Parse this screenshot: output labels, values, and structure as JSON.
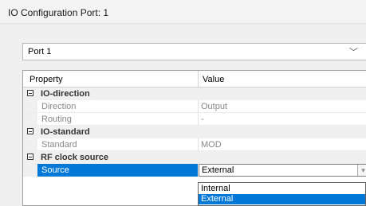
{
  "window": {
    "title": "IO Configuration Port: 1"
  },
  "port_select": {
    "value": "Port 1",
    "arrow": "﹀"
  },
  "grid": {
    "header": {
      "property": "Property",
      "value": "Value"
    },
    "categories": [
      {
        "label": "IO-direction",
        "properties": [
          {
            "label": "Direction",
            "value": "Output"
          },
          {
            "label": "Routing",
            "value": "-"
          }
        ]
      },
      {
        "label": "IO-standard",
        "properties": [
          {
            "label": "Standard",
            "value": "MOD"
          }
        ]
      },
      {
        "label": "RF clock source",
        "properties": [
          {
            "label": "Source",
            "value": "External",
            "selected": true
          }
        ]
      }
    ]
  },
  "dropdown": {
    "options": [
      "Internal",
      "External"
    ],
    "selected": "External"
  }
}
